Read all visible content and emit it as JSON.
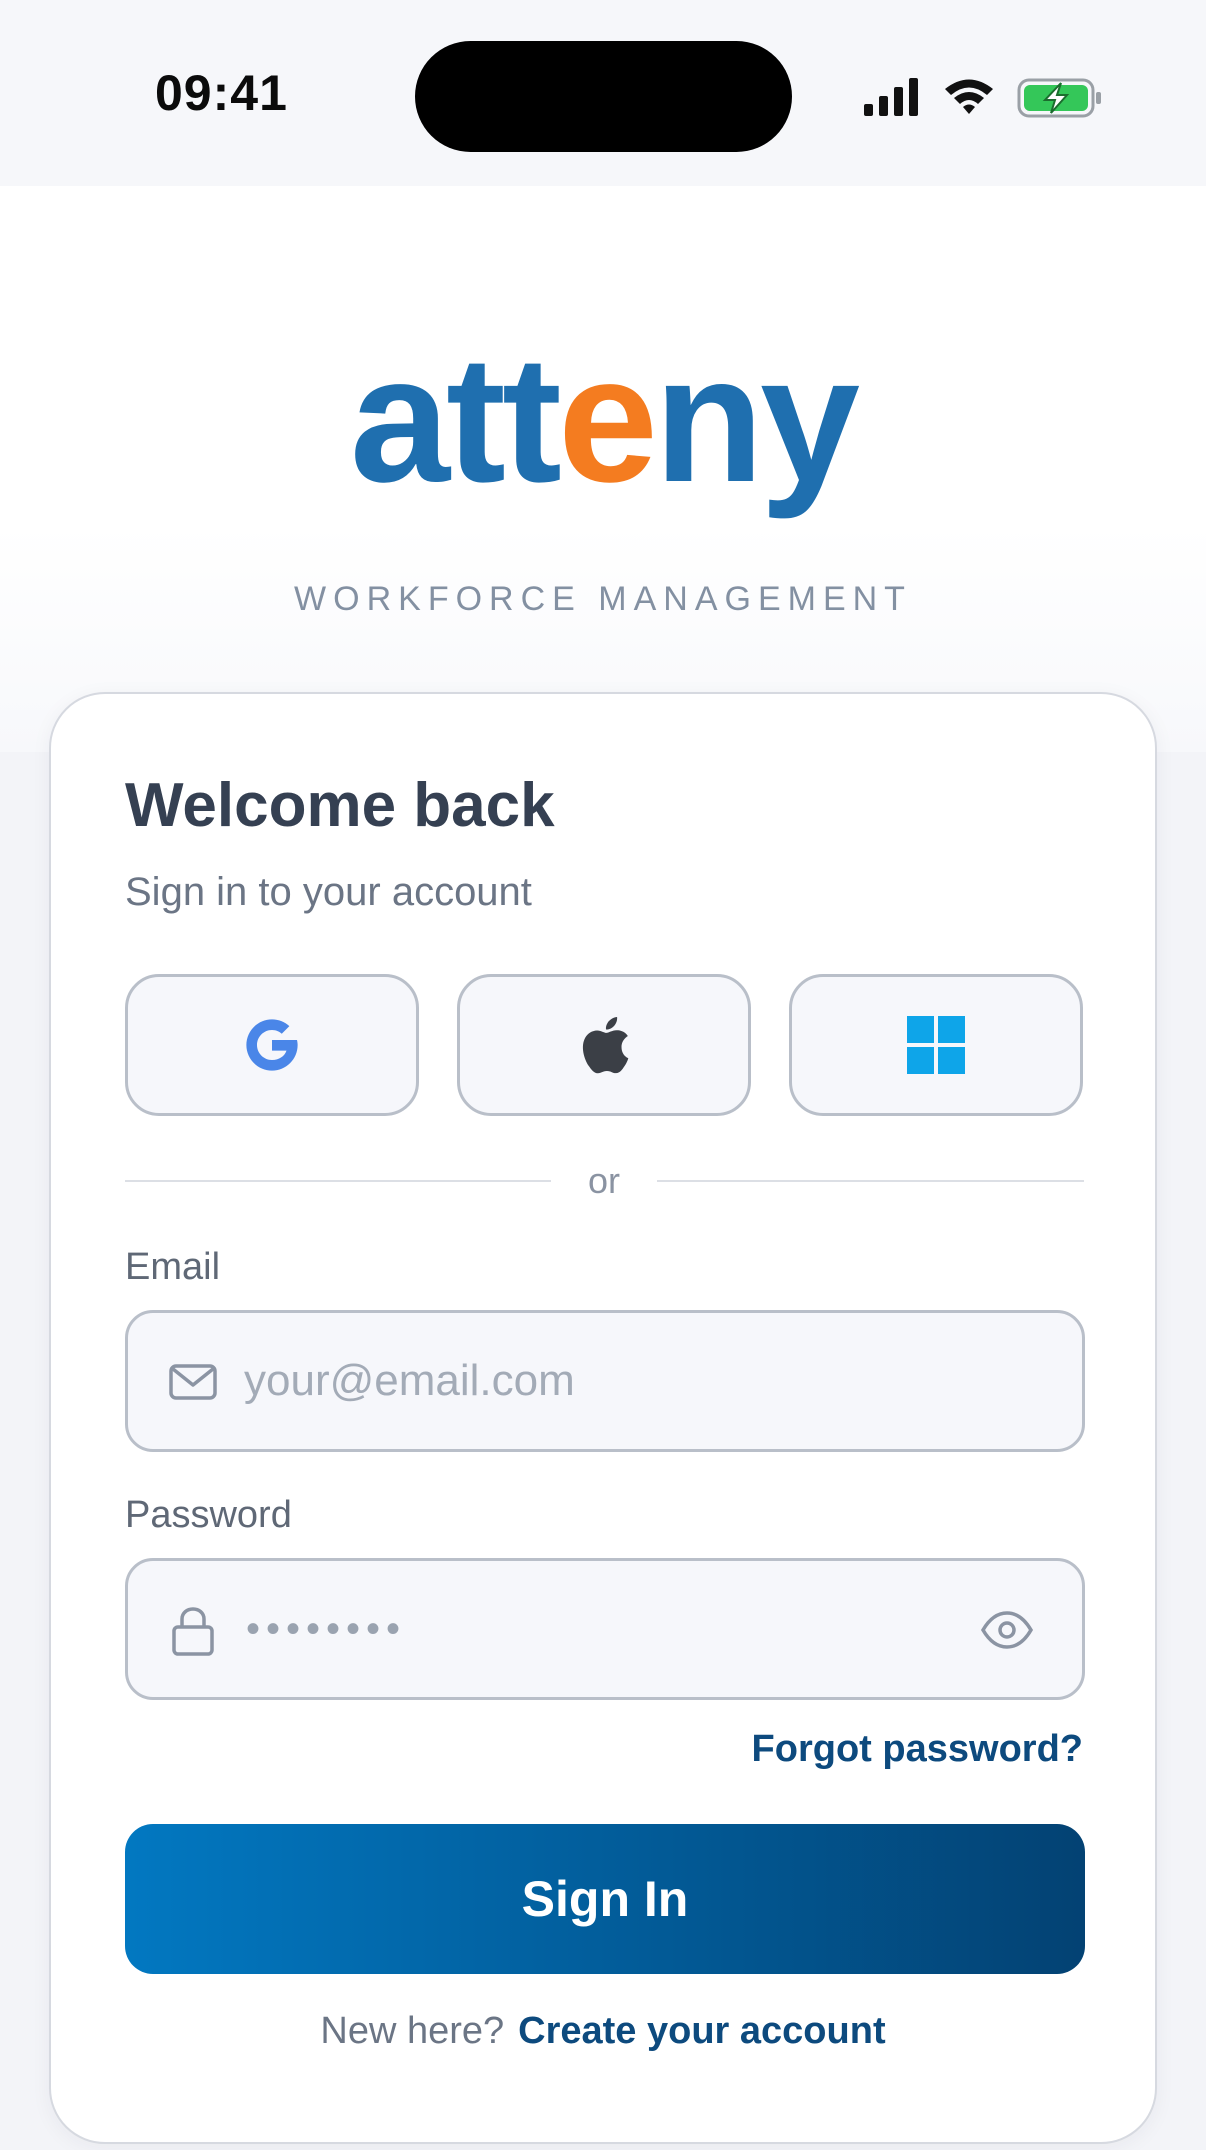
{
  "status_bar": {
    "time": "09:41",
    "icons": [
      "signal-icon",
      "wifi-icon",
      "battery-charging-icon"
    ]
  },
  "brand": {
    "logo_text_before": "att",
    "logo_text_accent": "e",
    "logo_text_after": "ny",
    "tagline": "WORKFORCE MANAGEMENT",
    "primary_color": "#1f6faf",
    "accent_color": "#f47c20"
  },
  "card": {
    "title": "Welcome back",
    "subtitle": "Sign in to your account",
    "social_buttons": [
      {
        "provider": "google",
        "icon": "google-icon"
      },
      {
        "provider": "apple",
        "icon": "apple-icon"
      },
      {
        "provider": "microsoft",
        "icon": "microsoft-icon"
      }
    ],
    "divider_text": "or",
    "email": {
      "label": "Email",
      "placeholder": "your@email.com",
      "value": "",
      "icon": "mail-icon"
    },
    "password": {
      "label": "Password",
      "masked_value": "••••••••",
      "icon": "lock-icon",
      "toggle_icon": "eye-icon"
    },
    "forgot_password": "Forgot password?",
    "sign_in_label": "Sign In",
    "sign_in_gradient": [
      "#0278c1",
      "#034273"
    ],
    "footer_prompt": "New here?",
    "create_account": "Create your account"
  }
}
